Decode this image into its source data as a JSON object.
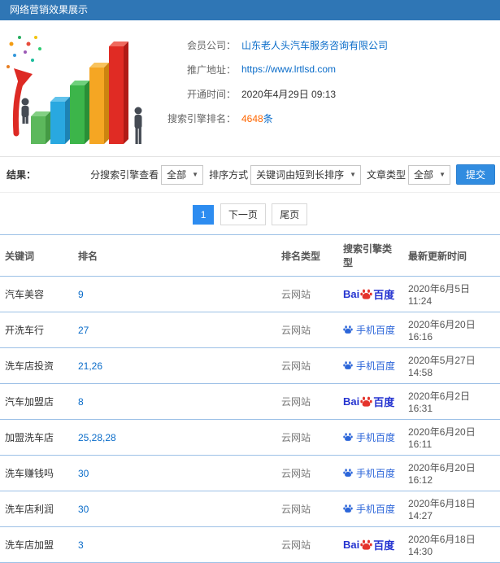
{
  "titlebar": {
    "title": "网络营销效果展示"
  },
  "info": {
    "company_label": "会员公司：",
    "company_value": "山东老人头汽车服务咨询有限公司",
    "url_label": "推广地址：",
    "url_value": "https://www.lrtlsd.com",
    "open_label": "开通时间：",
    "open_value": "2020年4月29日 09:13",
    "rank_label": "搜索引擎排名：",
    "rank_value": "4648",
    "rank_suffix": "条"
  },
  "filters": {
    "result_label": "结果：",
    "engine_label": "分搜索引擎查看",
    "engine_value": "全部",
    "sort_label": "排序方式",
    "sort_value": "关键词由短到长排序",
    "type_label": "文章类型",
    "type_value": "全部",
    "submit_label": "提交"
  },
  "pagination": {
    "current": "1",
    "next_label": "下一页",
    "last_label": "尾页"
  },
  "table": {
    "headers": [
      "关键词",
      "排名",
      "排名类型",
      "搜索引擎类型",
      "最新更新时间"
    ],
    "rows": [
      {
        "keyword": "汽车美容",
        "rank": "9",
        "rank_type": "云网站",
        "engine": {
          "type": "pc",
          "prefix": "Bai",
          "label": "百度"
        },
        "updated": "2020年6月5日 11:24"
      },
      {
        "keyword": "开洗车行",
        "rank": "27",
        "rank_type": "云网站",
        "engine": {
          "type": "mobile",
          "prefix": "",
          "label": "手机百度"
        },
        "updated": "2020年6月20日 16:16"
      },
      {
        "keyword": "洗车店投资",
        "rank": "21,26",
        "rank_type": "云网站",
        "engine": {
          "type": "mobile",
          "prefix": "",
          "label": "手机百度"
        },
        "updated": "2020年5月27日 14:58"
      },
      {
        "keyword": "汽车加盟店",
        "rank": "8",
        "rank_type": "云网站",
        "engine": {
          "type": "pc",
          "prefix": "Bai",
          "label": "百度"
        },
        "updated": "2020年6月2日 16:31"
      },
      {
        "keyword": "加盟洗车店",
        "rank": "25,28,28",
        "rank_type": "云网站",
        "engine": {
          "type": "mobile",
          "prefix": "",
          "label": "手机百度"
        },
        "updated": "2020年6月20日 16:11"
      },
      {
        "keyword": "洗车赚钱吗",
        "rank": "30",
        "rank_type": "云网站",
        "engine": {
          "type": "mobile",
          "prefix": "",
          "label": "手机百度"
        },
        "updated": "2020年6月20日 16:12"
      },
      {
        "keyword": "洗车店利润",
        "rank": "30",
        "rank_type": "云网站",
        "engine": {
          "type": "mobile",
          "prefix": "",
          "label": "手机百度"
        },
        "updated": "2020年6月18日 14:27"
      },
      {
        "keyword": "洗车店加盟",
        "rank": "3",
        "rank_type": "云网站",
        "engine": {
          "type": "pc",
          "prefix": "Bai",
          "label": "百度"
        },
        "updated": "2020年6月18日 14:30"
      }
    ]
  },
  "colors": {
    "titlebar_blue": "#2f76b5",
    "link_blue": "#0a6cc9",
    "highlight_orange": "#ff6600",
    "accent_button_blue": "#318ce0",
    "baidu_blue": "#2433d0",
    "baidu_paw_red": "#e4342c",
    "mobile_baidu_blue": "#2b65d9",
    "table_line_blue": "#9cc0e6"
  }
}
